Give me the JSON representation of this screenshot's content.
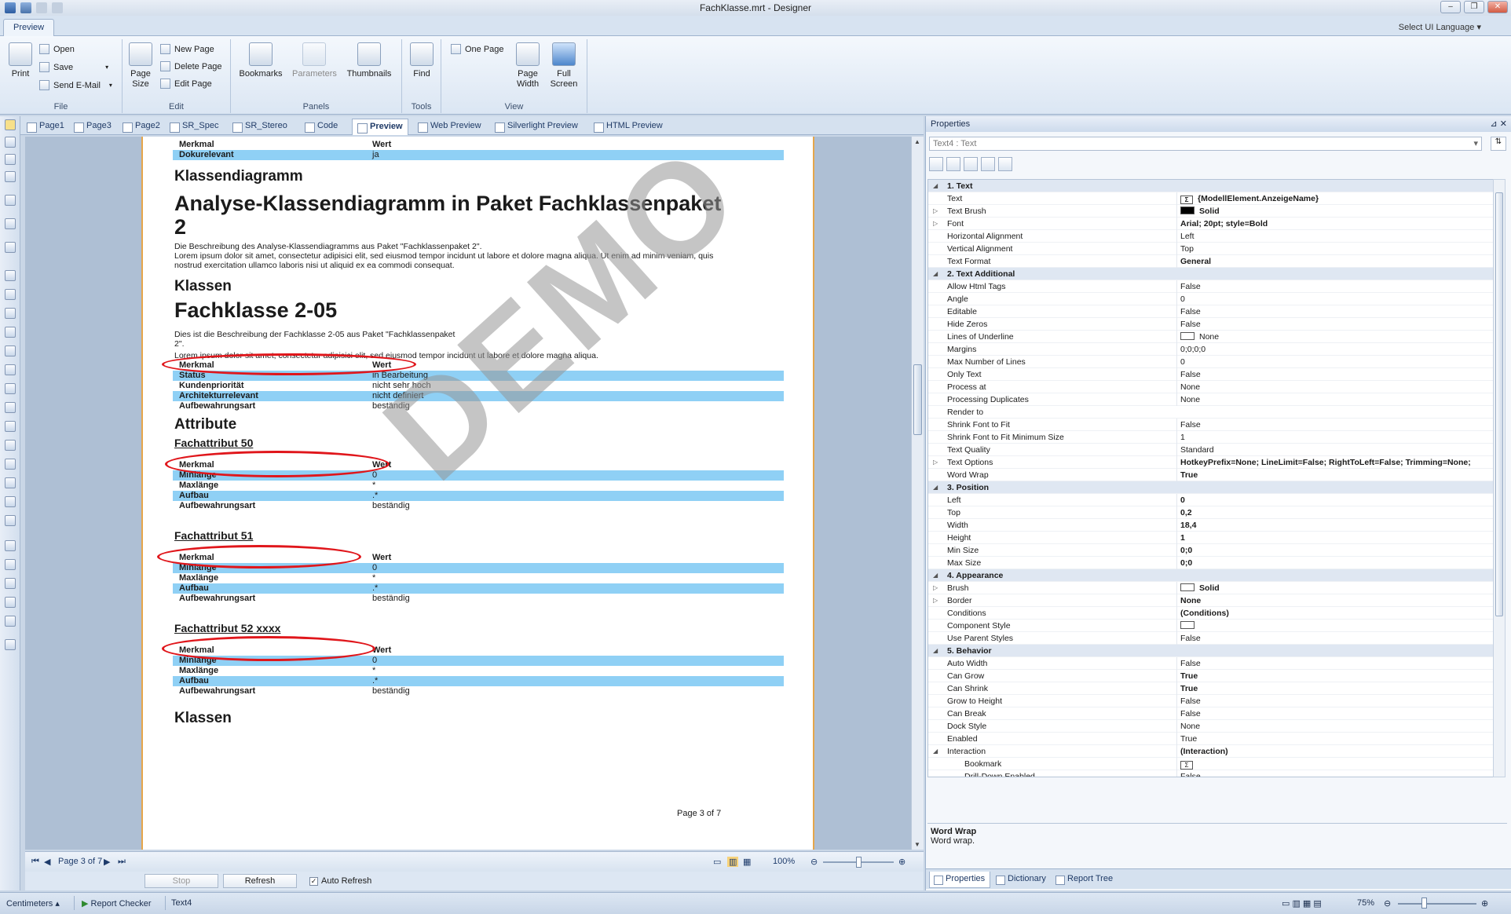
{
  "window": {
    "title": "FachKlasse.mrt - Designer"
  },
  "ribbon": {
    "tab": "Preview",
    "language_select": "Select UI Language",
    "groups": {
      "file": {
        "name": "File",
        "print": "Print",
        "open": "Open",
        "save": "Save",
        "send_email": "Send E-Mail"
      },
      "edit": {
        "name": "Edit",
        "page_size": "Page Size",
        "new_page": "New Page",
        "delete_page": "Delete Page",
        "edit_page": "Edit Page"
      },
      "panels": {
        "name": "Panels",
        "bookmarks": "Bookmarks",
        "parameters": "Parameters",
        "thumbnails": "Thumbnails"
      },
      "tools": {
        "name": "Tools",
        "find": "Find"
      },
      "view": {
        "name": "View",
        "one_page": "One Page",
        "page_width": "Page Width",
        "full_screen": "Full Screen"
      }
    }
  },
  "doc_tabs": [
    "Page1",
    "Page3",
    "Page2",
    "SR_Spec",
    "SR_Stereo",
    "Code",
    "Preview",
    "Web Preview",
    "Silverlight Preview",
    "HTML Preview"
  ],
  "report": {
    "top_header": {
      "c1": "Merkmal",
      "c2": "Wert"
    },
    "top_row": {
      "c1": "Dokurelevant",
      "c2": "ja"
    },
    "klassendiagramm": "Klassendiagramm",
    "title_line1": "Analyse-Klassendiagramm in Paket Fachklassenpaket",
    "title_line2": "2",
    "desc1": "Die Beschreibung des Analyse-Klassendiagramms aus Paket \"Fachklassenpaket 2\".",
    "lorem1_line1": "Lorem ipsum dolor sit amet, consectetur adipisici elit, sed eiusmod tempor incidunt ut labore et dolore magna aliqua. Ut enim ad minim veniam, quis",
    "lorem1_line2": "nostrud exercitation ullamco laboris nisi ut aliquid ex ea commodi consequat.",
    "klassen": "Klassen",
    "fachklasse": "Fachklasse 2-05",
    "desc2_line1": "Dies ist die Beschreibung der Fachklasse 2-05 aus Paket \"Fachklassenpaket",
    "desc2_line2": "2\".",
    "lorem2": "Lorem ipsum dolor sit amet, consectetur adipisici elit, sed eiusmod tempor incidunt ut labore et dolore magna aliqua.",
    "class_table": [
      {
        "c1": "Merkmal",
        "c2": "Wert"
      },
      {
        "c1": "Status",
        "c2": "in Bearbeitung"
      },
      {
        "c1": "Kundenpriorität",
        "c2": "nicht sehr hoch"
      },
      {
        "c1": "Architekturrelevant",
        "c2": "nicht definiert"
      },
      {
        "c1": "Aufbewahrungsart",
        "c2": "beständig"
      }
    ],
    "attribute": "Attribute",
    "attr_tables": [
      {
        "title": "Fachattribut 50",
        "rows": [
          {
            "c1": "Merkmal",
            "c2": "Wert"
          },
          {
            "c1": "Minlänge",
            "c2": "0"
          },
          {
            "c1": "Maxlänge",
            "c2": "*"
          },
          {
            "c1": "Aufbau",
            "c2": ".*"
          },
          {
            "c1": "Aufbewahrungsart",
            "c2": "beständig"
          }
        ]
      },
      {
        "title": "Fachattribut 51",
        "rows": [
          {
            "c1": "Merkmal",
            "c2": "Wert"
          },
          {
            "c1": "Minlänge",
            "c2": "0"
          },
          {
            "c1": "Maxlänge",
            "c2": "*"
          },
          {
            "c1": "Aufbau",
            "c2": ".*"
          },
          {
            "c1": "Aufbewahrungsart",
            "c2": "beständig"
          }
        ]
      },
      {
        "title": "Fachattribut 52 xxxx",
        "rows": [
          {
            "c1": "Merkmal",
            "c2": "Wert"
          },
          {
            "c1": "Minlänge",
            "c2": "0"
          },
          {
            "c1": "Maxlänge",
            "c2": "*"
          },
          {
            "c1": "Aufbau",
            "c2": ".*"
          },
          {
            "c1": "Aufbewahrungsart",
            "c2": "beständig"
          }
        ]
      }
    ],
    "klassen_bottom": "Klassen",
    "page_label": "Page 3 of 7",
    "watermark": "DEMO"
  },
  "preview_nav": {
    "page": "Page 3 of 7",
    "zoom": "100%"
  },
  "refresh_bar": {
    "stop": "Stop",
    "refresh": "Refresh",
    "auto_refresh": "Auto Refresh",
    "auto_refresh_checked": true
  },
  "properties": {
    "title": "Properties",
    "component": "Text4 : Text",
    "rows": [
      {
        "type": "cat",
        "name": "1. Text"
      },
      {
        "name": "Text",
        "value": "{ModellElement.AnzeigeName}",
        "icon": "expression",
        "bold": true
      },
      {
        "name": "Text Brush",
        "value": "Solid",
        "swatch": "#000000",
        "expand": true,
        "bold": true
      },
      {
        "name": "Font",
        "value": "Arial; 20pt; style=Bold",
        "expand": true,
        "bold": true
      },
      {
        "name": "Horizontal Alignment",
        "value": "Left"
      },
      {
        "name": "Vertical Alignment",
        "value": "Top"
      },
      {
        "name": "Text Format",
        "value": "General",
        "bold": true
      },
      {
        "type": "cat",
        "name": "2. Text  Additional"
      },
      {
        "name": "Allow Html Tags",
        "value": "False"
      },
      {
        "name": "Angle",
        "value": "0"
      },
      {
        "name": "Editable",
        "value": "False"
      },
      {
        "name": "Hide Zeros",
        "value": "False"
      },
      {
        "name": "Lines of Underline",
        "value": "None",
        "swatch": "#ffffff"
      },
      {
        "name": "Margins",
        "value": "0;0;0;0"
      },
      {
        "name": "Max Number of Lines",
        "value": "0"
      },
      {
        "name": "Only Text",
        "value": "False"
      },
      {
        "name": "Process at",
        "value": "None"
      },
      {
        "name": "Processing Duplicates",
        "value": "None"
      },
      {
        "name": "Render to",
        "value": ""
      },
      {
        "name": "Shrink Font to Fit",
        "value": "False"
      },
      {
        "name": "Shrink Font to Fit Minimum Size",
        "value": "1"
      },
      {
        "name": "Text Quality",
        "value": "Standard"
      },
      {
        "name": "Text Options",
        "value": "HotkeyPrefix=None; LineLimit=False; RightToLeft=False; Trimming=None;",
        "expand": true,
        "bold": true
      },
      {
        "name": "Word Wrap",
        "value": "True",
        "bold": true,
        "selected": true
      },
      {
        "type": "cat",
        "name": "3. Position"
      },
      {
        "name": "Left",
        "value": "0",
        "bold": true
      },
      {
        "name": "Top",
        "value": "0,2",
        "bold": true
      },
      {
        "name": "Width",
        "value": "18,4",
        "bold": true
      },
      {
        "name": "Height",
        "value": "1",
        "bold": true
      },
      {
        "name": "Min Size",
        "value": "0;0",
        "bold": true
      },
      {
        "name": "Max Size",
        "value": "0;0",
        "bold": true
      },
      {
        "type": "cat",
        "name": "4. Appearance"
      },
      {
        "name": "Brush",
        "value": "Solid",
        "swatch": "#ffffff",
        "expand": true,
        "bold": true
      },
      {
        "name": "Border",
        "value": "None",
        "expand": true,
        "bold": true
      },
      {
        "name": "Conditions",
        "value": "(Conditions)",
        "bold": true
      },
      {
        "name": "Component Style",
        "value": "",
        "swatch": "#ffffff"
      },
      {
        "name": "Use Parent Styles",
        "value": "False"
      },
      {
        "type": "cat",
        "name": "5. Behavior"
      },
      {
        "name": "Auto Width",
        "value": "False"
      },
      {
        "name": "Can Grow",
        "value": "True",
        "bold": true
      },
      {
        "name": "Can Shrink",
        "value": "True",
        "bold": true
      },
      {
        "name": "Grow to Height",
        "value": "False"
      },
      {
        "name": "Can Break",
        "value": "False"
      },
      {
        "name": "Dock Style",
        "value": "None"
      },
      {
        "name": "Enabled",
        "value": "True"
      },
      {
        "name": "Interaction",
        "value": "(Interaction)",
        "collapse": true,
        "bold": true
      },
      {
        "name": "Bookmark",
        "value": "",
        "icon": "expression",
        "sub": true
      },
      {
        "name": "Drill-Down Enabled",
        "value": "False",
        "sub": true
      },
      {
        "name": "Drill-Down Page",
        "value": "",
        "sub": true
      },
      {
        "name": "Drill-Down Report",
        "value": "",
        "sub": true
      },
      {
        "name": "Drill-Down Parameter 1",
        "value": "{}",
        "sub": true,
        "expand": true,
        "bold": true
      }
    ],
    "description_title": "Word Wrap",
    "description_text": "Word wrap.",
    "tabs": [
      "Properties",
      "Dictionary",
      "Report Tree"
    ]
  },
  "statusbar": {
    "units": "Centimeters",
    "report_checker": "Report Checker",
    "component": "Text4",
    "zoom": "75%"
  }
}
